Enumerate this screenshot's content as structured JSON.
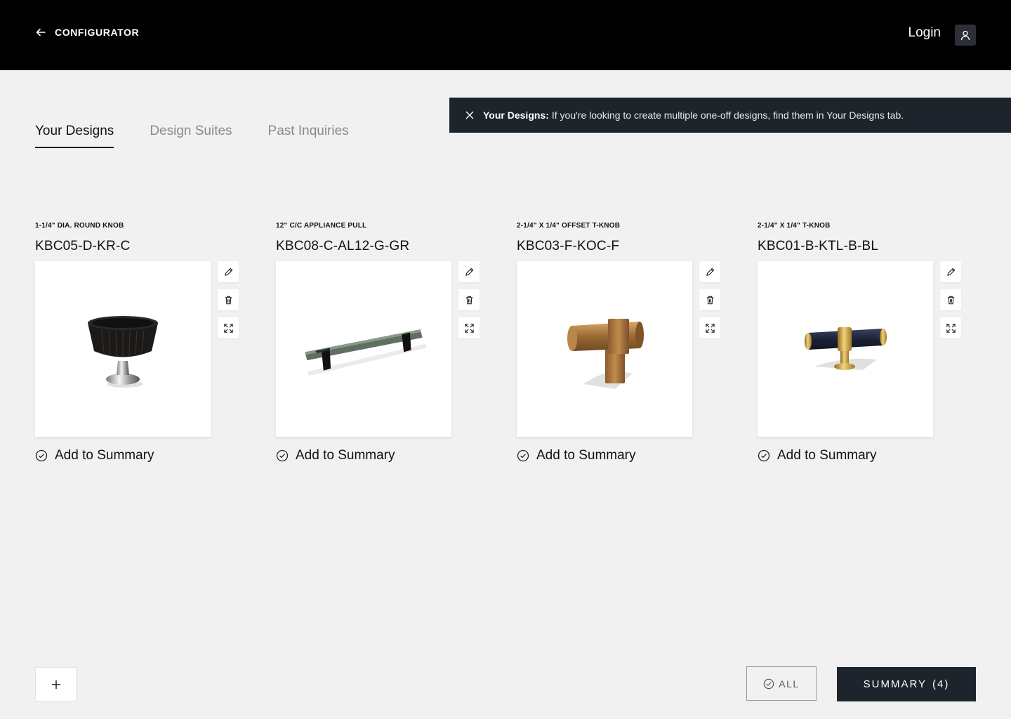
{
  "header": {
    "back_label": "CONFIGURATOR",
    "login_label": "Login"
  },
  "tabs": [
    {
      "label": "Your Designs",
      "active": true
    },
    {
      "label": "Design Suites",
      "active": false
    },
    {
      "label": "Past Inquiries",
      "active": false
    }
  ],
  "banner": {
    "title": "Your Designs:",
    "message": "If you're looking to create multiple one-off designs, find them in Your Designs tab."
  },
  "designs": [
    {
      "type": "1-1/4\" DIA. ROUND KNOB",
      "code": "KBC05-D-KR-C",
      "add_label": "Add to Summary"
    },
    {
      "type": "12\" C/C APPLIANCE PULL",
      "code": "KBC08-C-AL12-G-GR",
      "add_label": "Add to Summary"
    },
    {
      "type": "2-1/4\" X 1/4\" OFFSET T-KNOB",
      "code": "KBC03-F-KOC-F",
      "add_label": "Add to Summary"
    },
    {
      "type": "2-1/4\" X 1/4\" T-KNOB",
      "code": "KBC01-B-KTL-B-BL",
      "add_label": "Add to Summary"
    }
  ],
  "footer": {
    "all_label": "ALL",
    "summary_label": "SUMMARY",
    "summary_count": "(4)"
  },
  "icons": {
    "back": "arrow-left-icon",
    "user": "user-icon",
    "close": "close-icon",
    "edit": "pencil-icon",
    "delete": "trash-icon",
    "expand": "expand-icon",
    "check": "check-circle-icon",
    "add": "plus-icon"
  },
  "colors": {
    "header_bg": "#000000",
    "banner_bg": "#1d242c",
    "page_bg": "#f1f1f1",
    "primary_button": "#1d242c"
  }
}
